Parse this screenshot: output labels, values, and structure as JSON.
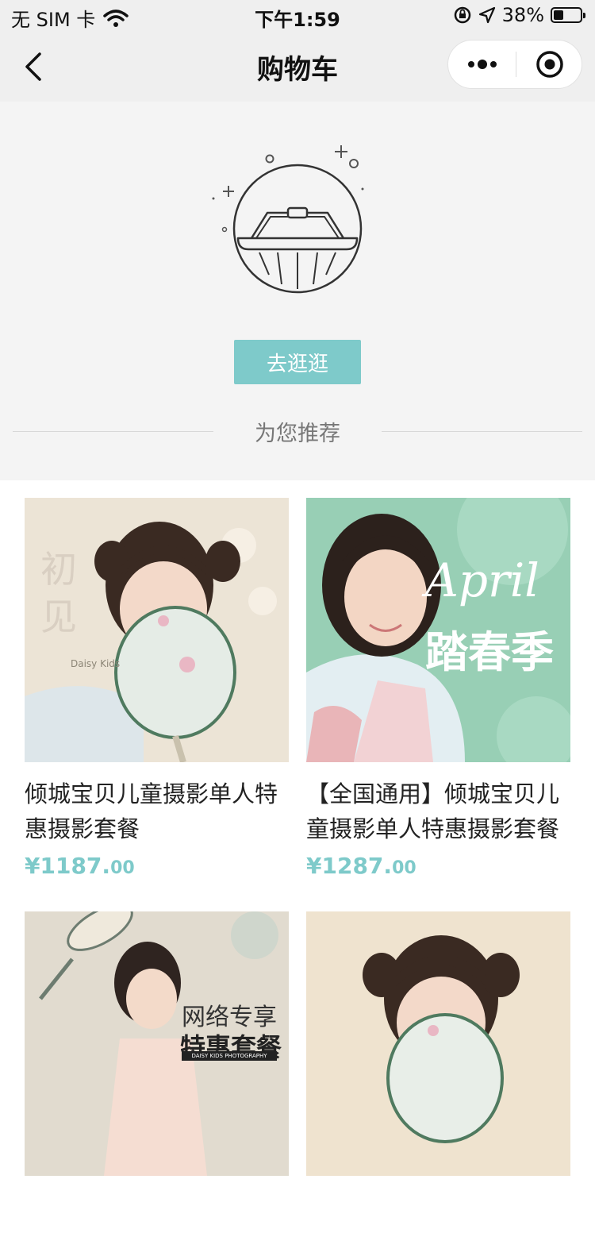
{
  "status_bar": {
    "carrier": "无 SIM 卡",
    "time": "下午1:59",
    "battery_text": "38%",
    "battery_level": 0.38
  },
  "nav": {
    "title": "购物车"
  },
  "empty_cart": {
    "go_button_label": "去逛逛",
    "recommend_title": "为您推荐"
  },
  "products": [
    {
      "title": "倾城宝贝儿童摄影单人特惠摄影套餐",
      "price_main": "¥1187.",
      "price_decimal": "00",
      "overlay_text": "初见",
      "overlay_sub": "Daisy Kids"
    },
    {
      "title": "【全国通用】倾城宝贝儿童摄影单人特惠摄影套餐",
      "price_main": "¥1287.",
      "price_decimal": "00",
      "overlay_text": "April",
      "overlay_sub": "踏春季"
    },
    {
      "title": "",
      "overlay_text": "网络专享",
      "overlay_sub": "特惠套餐",
      "overlay_foot": "DAISY KIDS PHOTOGRAPHY"
    },
    {
      "title": ""
    }
  ],
  "colors": {
    "accent": "#7ecaca",
    "nav_bg": "#efefef",
    "empty_bg": "#f4f4f4"
  }
}
